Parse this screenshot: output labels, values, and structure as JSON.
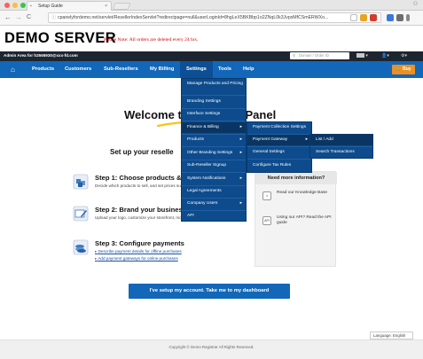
{
  "browser": {
    "tab_title": "Setup Guide",
    "tab_close": "×",
    "url": "cpanelyfordemo.net/servlet/ResellerIndexServlet?redirectpage=null&userLoginId=8hgLeX5BKBbp1o2ZNqL0k3JvpxMfCSmERWXo...",
    "back": "←",
    "forward": "→",
    "reload": "C"
  },
  "header": {
    "brand": "DEMO SERVER",
    "note": "Please Note: All orders are deleted every 24 hrs."
  },
  "topbar": {
    "admin_label": "Admin Area for h2565930@xxx-fd.com",
    "search_placeholder": "Domain / Order ID",
    "search_icon": "⚲",
    "flag_dropdown": "▾",
    "user_dropdown": "▾",
    "tools_dropdown": "▾"
  },
  "nav": {
    "home_icon": "⌂",
    "items": [
      "Products",
      "Customers",
      "Sub-Resellers",
      "My Billing",
      "Settings",
      "Tools",
      "Help"
    ],
    "buy_label": "Buy"
  },
  "settings_menu": [
    "Manage Products and Pricing",
    "Branding Settings",
    "Interface Settings",
    "Finance & Billing",
    "Products",
    "Other Branding Settings",
    "Sub-Reseller Signup",
    "System Notifications",
    "Legal Agreements",
    "Company Users",
    "API"
  ],
  "finance_menu": [
    "Payment Collection Settings",
    "Payment Gateway",
    "General Settings",
    "Configure Tax Rules"
  ],
  "gateway_menu": [
    "List / Add",
    "Search Transactions"
  ],
  "main": {
    "welcome_left": "Welcome t",
    "welcome_right": "ntrol Panel",
    "setup_title": "Set up your reselle",
    "step1_title": "Step 1: Choose products &",
    "step1_desc": "Decide which products to sell, and set prices sub-resellers",
    "step2_title": "Step 2: Brand your busines",
    "step2_desc": "Upload your logo, customize your storefront, more",
    "step3_title": "Step 3: Configure payments",
    "step3_link1": "Describe payment details for offline purchases",
    "step3_link2": "Add payment gateways for online purchases",
    "info_title": "Need more information?",
    "info_kb": "Read our Knowledge Base",
    "info_api": "Using our API? Read the API guide",
    "info_api_icon": "API",
    "cta": "I've setup my account. Take me to my dashboard"
  },
  "footer": {
    "language": "Language: English",
    "copyright": "Copyright © Demo Registrar All Rights Reserved."
  },
  "colors": {
    "nav_blue": "#1267b8",
    "menu_blue": "#0d4b8c",
    "buy_orange": "#f08f1d",
    "dark_bar": "#1d2530",
    "note_red": "#cc0000"
  }
}
